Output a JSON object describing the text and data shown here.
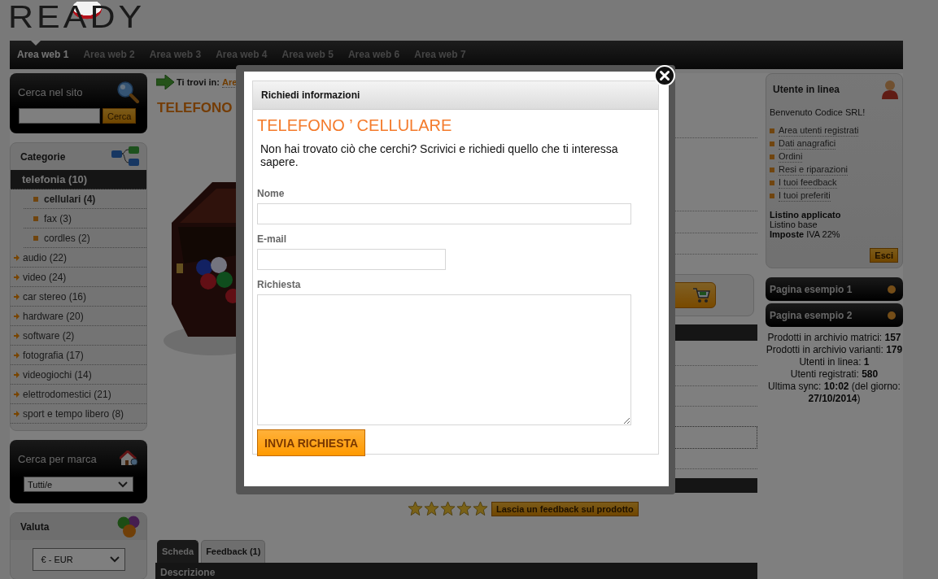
{
  "logo": {
    "text": "READY"
  },
  "nav": [
    {
      "label": "Area web 1",
      "selected": true
    },
    {
      "label": "Area web 2",
      "selected": false
    },
    {
      "label": "Area web 3",
      "selected": false
    },
    {
      "label": "Area web 4",
      "selected": false
    },
    {
      "label": "Area web 5",
      "selected": false
    },
    {
      "label": "Area web 6",
      "selected": false
    },
    {
      "label": "Area web 7",
      "selected": false
    }
  ],
  "site_search": {
    "title": "Cerca nel sito",
    "button": "Cerca"
  },
  "categories": {
    "title": "Categorie",
    "items": [
      {
        "label": "telefonia (10)",
        "selected": true,
        "children": [
          {
            "label": "cellulari (4)",
            "selected": true
          },
          {
            "label": "fax (3)",
            "selected": false
          },
          {
            "label": "cordles (2)",
            "selected": false
          }
        ]
      },
      {
        "label": "audio (22)",
        "selected": false
      },
      {
        "label": "video (24)",
        "selected": false
      },
      {
        "label": "car stereo (16)",
        "selected": false
      },
      {
        "label": "hardware (20)",
        "selected": false
      },
      {
        "label": "software (2)",
        "selected": false
      },
      {
        "label": "fotografia (17)",
        "selected": false
      },
      {
        "label": "videogiochi (14)",
        "selected": false
      },
      {
        "label": "elettrodomestici (21)",
        "selected": false
      },
      {
        "label": "sport e tempo libero (8)",
        "selected": false
      }
    ]
  },
  "brand_search": {
    "title": "Cerca per marca",
    "value": "Tutti/e"
  },
  "currency": {
    "title": "Valuta",
    "value": "€ - EUR"
  },
  "breadcrumb": {
    "label": "Ti trovi in:",
    "link": "Are"
  },
  "product_title": "TELEFONO",
  "rating": {
    "stars": 5,
    "button": "Lascia un feedback sul prodotto"
  },
  "tabs": [
    {
      "label": "Scheda",
      "selected": true
    },
    {
      "label": "Feedback (1)",
      "selected": false
    }
  ],
  "section_header": "Descrizione",
  "user_panel": {
    "title": "Utente in linea",
    "welcome": "Benvenuto Codice SRL!",
    "links": [
      "Area utenti registrati",
      "Dati anagrafici",
      "Ordini",
      "Resi e riparazioni",
      "I tuoi feedback",
      "I tuoi preferiti"
    ],
    "pricelist_label": "Listino applicato",
    "pricelist": "Listino base",
    "tax": "**Imposte** IVA 22%",
    "logout": "Esci"
  },
  "pages": [
    "Pagina esempio 1",
    "Pagina esempio 2"
  ],
  "stats": [
    "Prodotti in archivio matrici: **157**",
    "Prodotti in archivio varianti: **179**",
    "Utenti in linea: **1**",
    "Utenti registrati: **580**",
    "Ultima sync: **10:02** (del giorno: **27/10/2014**)"
  ],
  "dialog": {
    "header": "Richiedi informazioni",
    "title": "TELEFONO ’ CELLULARE",
    "intro": "Non hai trovato ciò che cerchi? Scrivici e richiedi quello che ti interessa sapere.",
    "fields": [
      {
        "kind": "input",
        "label": "Nome"
      },
      {
        "kind": "short-input",
        "label": "E-mail"
      },
      {
        "kind": "textarea",
        "label": "Richiesta"
      }
    ],
    "submit": "INVIA RICHIESTA"
  }
}
